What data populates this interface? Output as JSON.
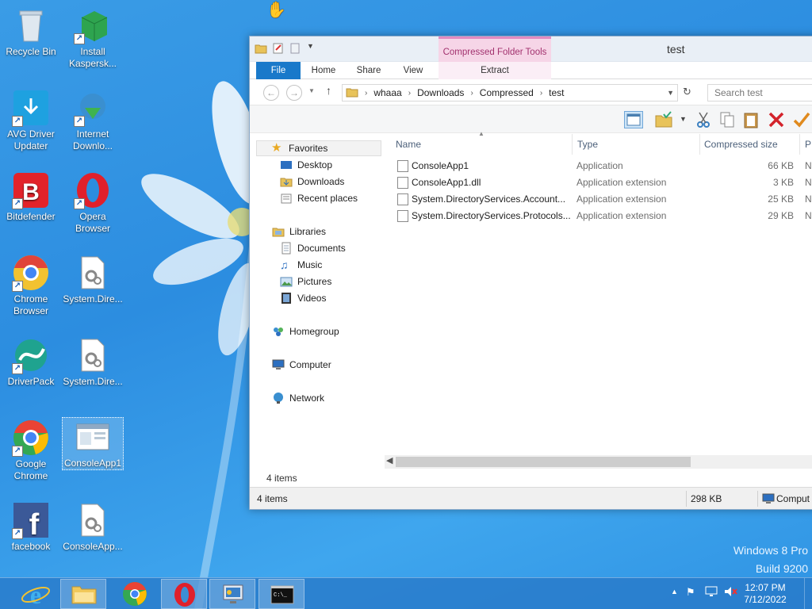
{
  "desktop": {
    "icons": [
      {
        "label": "Recycle Bin"
      },
      {
        "label": "Install Kaspersk..."
      },
      {
        "label": "AVG Driver Updater"
      },
      {
        "label": "Internet Downlo..."
      },
      {
        "label": "Bitdefender"
      },
      {
        "label": "Opera Browser"
      },
      {
        "label": "Chrome Browser"
      },
      {
        "label": "System.Dire..."
      },
      {
        "label": "DriverPack"
      },
      {
        "label": "System.Dire..."
      },
      {
        "label": "Google Chrome"
      },
      {
        "label": "ConsoleApp1"
      },
      {
        "label": "facebook"
      },
      {
        "label": "ConsoleApp..."
      }
    ]
  },
  "window": {
    "title": "test",
    "context_tab": "Compressed Folder Tools",
    "ribbon_tabs": {
      "file": "File",
      "home": "Home",
      "share": "Share",
      "view": "View",
      "extract": "Extract"
    },
    "breadcrumbs": [
      "whaaa",
      "Downloads",
      "Compressed",
      "test"
    ],
    "search_placeholder": "Search test",
    "nav": {
      "favorites": "Favorites",
      "desktop": "Desktop",
      "downloads": "Downloads",
      "recent": "Recent places",
      "libraries": "Libraries",
      "documents": "Documents",
      "music": "Music",
      "pictures": "Pictures",
      "videos": "Videos",
      "homegroup": "Homegroup",
      "computer": "Computer",
      "network": "Network"
    },
    "columns": {
      "name": "Name",
      "type": "Type",
      "compressed_size": "Compressed size",
      "p": "P"
    },
    "files": [
      {
        "name": "ConsoleApp1",
        "type": "Application",
        "size": "66 KB",
        "p": "N"
      },
      {
        "name": "ConsoleApp1.dll",
        "type": "Application extension",
        "size": "3 KB",
        "p": "N"
      },
      {
        "name": "System.DirectoryServices.Account...",
        "type": "Application extension",
        "size": "25 KB",
        "p": "N"
      },
      {
        "name": "System.DirectoryServices.Protocols...",
        "type": "Application extension",
        "size": "29 KB",
        "p": "N"
      }
    ],
    "items_count": "4 items",
    "status": {
      "items": "4 items",
      "size": "298 KB",
      "location": "Comput"
    }
  },
  "watermark": {
    "line1": "Windows 8 Pro",
    "line2": "Build 9200"
  },
  "taskbar": {
    "clock_time": "12:07 PM",
    "clock_date": "7/12/2022"
  },
  "colors": {
    "accent": "#1979ca",
    "context_tab": "#f6d5e7",
    "desktop": "#2c8de0"
  }
}
